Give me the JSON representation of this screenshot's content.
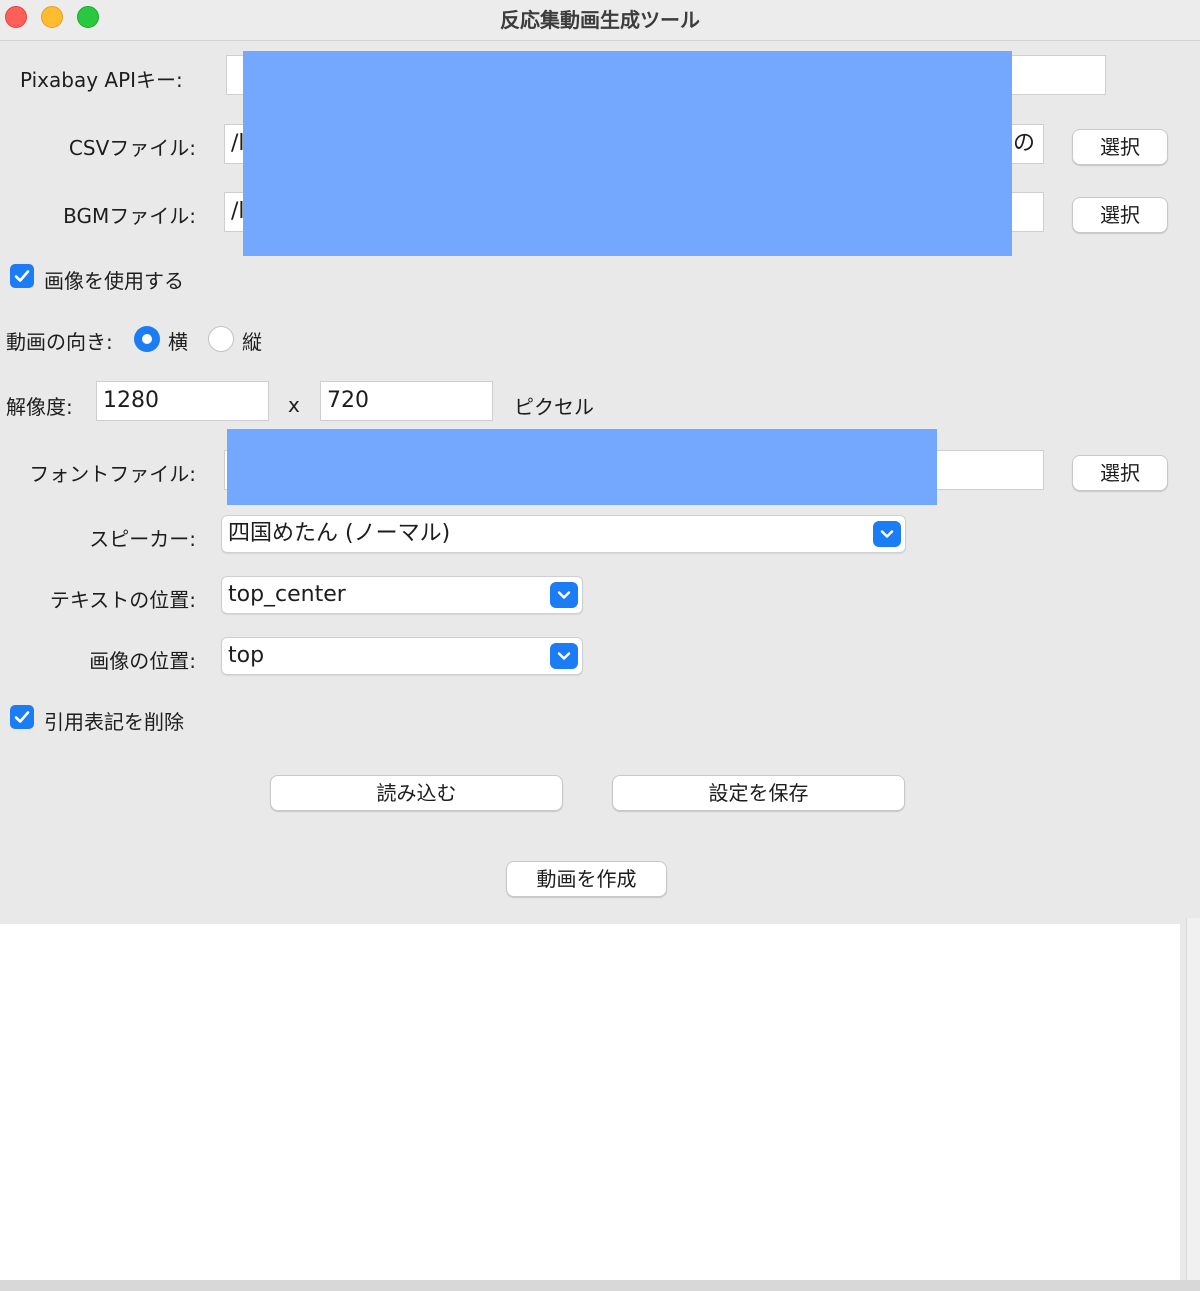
{
  "window": {
    "title": "反応集動画生成ツール"
  },
  "api_key": {
    "label": "Pixabay APIキー:",
    "value": ""
  },
  "csv": {
    "label": "CSVファイル:",
    "value_visible_left": "/l",
    "value_visible_right": "の",
    "button": "選択"
  },
  "bgm": {
    "label": "BGMファイル:",
    "value_visible_left": "/l",
    "button": "選択"
  },
  "use_images": {
    "label": "画像を使用する",
    "checked": true
  },
  "orientation": {
    "label": "動画の向き:",
    "options": [
      {
        "label": "横",
        "selected": true
      },
      {
        "label": "縦",
        "selected": false
      }
    ]
  },
  "resolution": {
    "label": "解像度:",
    "width": "1280",
    "x": "x",
    "height": "720",
    "unit": "ピクセル"
  },
  "font": {
    "label": "フォントファイル:",
    "button": "選択"
  },
  "speaker": {
    "label": "スピーカー:",
    "value": "四国めたん (ノーマル)"
  },
  "text_position": {
    "label": "テキストの位置:",
    "value": "top_center"
  },
  "image_position": {
    "label": "画像の位置:",
    "value": "top"
  },
  "remove_citations": {
    "label": "引用表記を削除",
    "checked": true
  },
  "actions": {
    "load": "読み込む",
    "save": "設定を保存",
    "create": "動画を作成"
  },
  "colors": {
    "accent": "#1c7cf4",
    "redaction": "#74a7fe",
    "window_bg": "#e9e9e9"
  }
}
